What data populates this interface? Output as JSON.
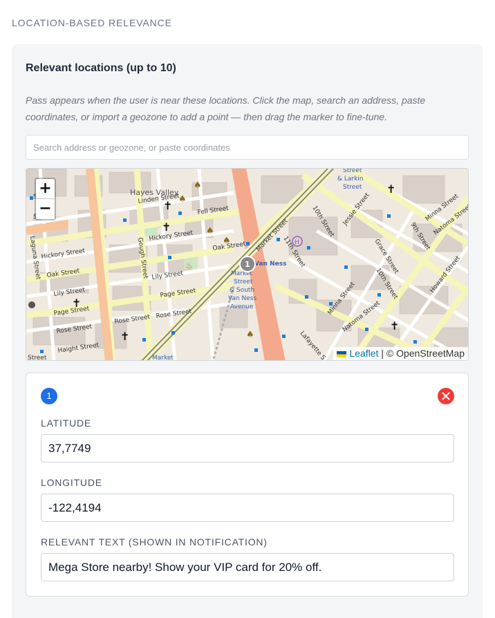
{
  "section": {
    "title": "LOCATION-BASED RELEVANCE"
  },
  "card": {
    "title": "Relevant locations (up to 10)",
    "description": "Pass appears when the user is near these locations. Click the map, search an address, paste coordinates, or import a geozone to add a point — then drag the marker to fine-tune."
  },
  "search": {
    "placeholder": "Search address or geozone, or paste coordinates"
  },
  "map": {
    "zoom_in_label": "+",
    "zoom_out_label": "−",
    "marker_label": "1",
    "attribution_leaflet": "Leaflet",
    "attribution_separator": "|",
    "attribution_osm": "© OpenStreetMap",
    "street_labels": {
      "hayes_valley": "Hayes Valley",
      "linden": "Linden Street",
      "fell": "Fell Street",
      "hickory_1": "Hickory Street",
      "hickory_2": "Hickory Street",
      "oak_1": "Oak Street",
      "oak_2": "Oak Street",
      "lily_1": "Lily Street",
      "lily_2": "Lily Street",
      "page_1": "Page Street",
      "page_2": "Page Street",
      "rose_1": "Rose Street",
      "rose_2": "Rose Street",
      "rose_3": "Rose Street",
      "haight": "Haight Street",
      "gough": "Gough Street",
      "laguna": "Laguna Street",
      "market_1": "Market Street",
      "market_2": "Market",
      "tenth_1": "10th Street",
      "tenth_2": "10th Street",
      "eleventh": "11th Street",
      "ninth": "9th Street",
      "jessie": "Jessie Street",
      "grace": "Grace Street",
      "minna_1": "Minna Street",
      "minna_2": "Minna Street",
      "natoma_1": "Natoma Street",
      "natoma_2": "Natoma Street",
      "howard": "Howard Street",
      "lafayette": "Lafayette S",
      "larkin": "Street & Larkin Street",
      "station": "Market Street & South Van Ness Avenue",
      "van_ness": "Van Ness",
      "linden_short": "Linden Street",
      "edge_street": "Street"
    },
    "colors": {
      "land": "#efe9df",
      "major_road": "#f7c49c",
      "secondary_road": "#f6f5ba",
      "minor_road": "#ffffff",
      "building": "#d9d0c9",
      "marker": "#888888"
    }
  },
  "location": {
    "index": "1",
    "latitude_label": "LATITUDE",
    "latitude_value": "37,7749",
    "longitude_label": "LONGITUDE",
    "longitude_value": "-122,4194",
    "text_label": "RELEVANT TEXT (SHOWN IN NOTIFICATION)",
    "text_value": "Mega Store nearby! Show your VIP card for 20% off."
  },
  "colors": {
    "badge": "#1f6fe5",
    "remove": "#ef3b37"
  }
}
